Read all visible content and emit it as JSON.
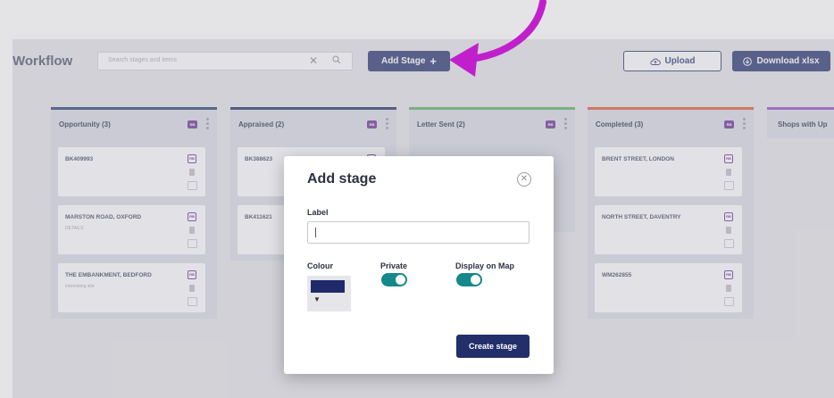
{
  "app": {
    "title": "Workflow"
  },
  "search": {
    "placeholder": "Search stages and items"
  },
  "toolbar": {
    "add_stage_label": "Add Stage",
    "upload_label": "Upload",
    "download_label": "Download xlsx"
  },
  "colors": {
    "primary": "#232f6b",
    "accent_arrow": "#c11fcc",
    "badge": "#6a2c91",
    "toggle_on": "#14888a",
    "swatch": "#1f2a6a",
    "stage_borders": [
      "#1c3d6e",
      "#1e2a5e",
      "#55b05a",
      "#e0542e",
      "#8a4bbf"
    ]
  },
  "columns": [
    {
      "title": "Opportunity (3)",
      "badge": "RB",
      "cards": [
        {
          "title": "BK409993",
          "subtitle": "",
          "badge": "RB"
        },
        {
          "title": "MARSTON ROAD, OXFORD",
          "subtitle": "DETAILS",
          "badge": "RB"
        },
        {
          "title": "THE EMBANKMENT, BEDFORD",
          "subtitle": "Interesting site",
          "badge": "RB"
        }
      ]
    },
    {
      "title": "Appraised (2)",
      "badge": "RB",
      "cards": [
        {
          "title": "BK388623",
          "subtitle": "",
          "badge": "RB"
        },
        {
          "title": "BK411621",
          "subtitle": "",
          "badge": "RB"
        }
      ]
    },
    {
      "title": "Letter Sent (2)",
      "badge": "RB",
      "cards": []
    },
    {
      "title": "Completed (3)",
      "badge": "RB",
      "cards": [
        {
          "title": "BRENT STREET, LONDON",
          "subtitle": "",
          "badge": "RB"
        },
        {
          "title": "NORTH STREET, DAVENTRY",
          "subtitle": "",
          "badge": "RB"
        },
        {
          "title": "WM262855",
          "subtitle": "",
          "badge": "RB"
        }
      ]
    },
    {
      "title": "Shops with Up",
      "badge": "",
      "cards": []
    }
  ],
  "modal": {
    "title": "Add stage",
    "label_field": {
      "label": "Label",
      "value": ""
    },
    "colour_label": "Colour",
    "private_label": "Private",
    "private_on": true,
    "map_label": "Display on Map",
    "map_on": true,
    "create_label": "Create stage",
    "close_icon": "close-icon"
  }
}
